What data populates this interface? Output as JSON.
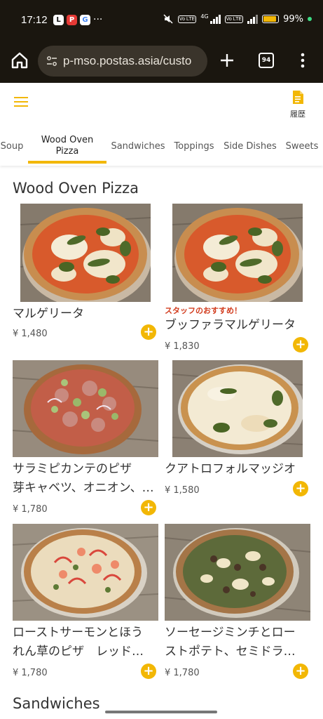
{
  "statusbar": {
    "time": "17:12",
    "apps": [
      "L",
      "P",
      "G"
    ],
    "more": "···",
    "network": "4G",
    "lte1": "Vo LTE",
    "lte2": "Vo LTE",
    "battery": "99%",
    "battery_level": 0.99
  },
  "browser": {
    "url": "p-mso.postas.asia/custo",
    "tab_count": "94"
  },
  "header": {
    "history_label": "履歴"
  },
  "category_tabs": [
    {
      "label": "Soup"
    },
    {
      "label": "Wood Oven\nPizza",
      "active": true
    },
    {
      "label": "Sandwiches"
    },
    {
      "label": "Toppings"
    },
    {
      "label": "Side Dishes"
    },
    {
      "label": "Sweets"
    }
  ],
  "section_title": "Wood Oven Pizza",
  "items": [
    {
      "name": "マルゲリータ",
      "price": "¥ 1,480",
      "recommend": ""
    },
    {
      "name": "ブッファラマルゲリータ",
      "price": "¥ 1,830",
      "recommend": "スタッフのおすすめ！"
    },
    {
      "name": "サラミピカンテのピザ\n芽キャベツ、オニオン、…",
      "price": "¥ 1,780",
      "recommend": ""
    },
    {
      "name": "クアトロフォルマッジオ",
      "price": "¥ 1,580",
      "recommend": ""
    },
    {
      "name": "ローストサーモンとほう\nれん草のピザ　レッド…",
      "price": "¥ 1,780",
      "recommend": ""
    },
    {
      "name": "ソーセージミンチとロー\nストポテト、セミドラ…",
      "price": "¥ 1,780",
      "recommend": ""
    }
  ],
  "next_section_title": "Sandwiches",
  "colors": {
    "accent": "#f2b705",
    "recommend": "#d23c1e",
    "browser_bg": "#1a160f"
  }
}
